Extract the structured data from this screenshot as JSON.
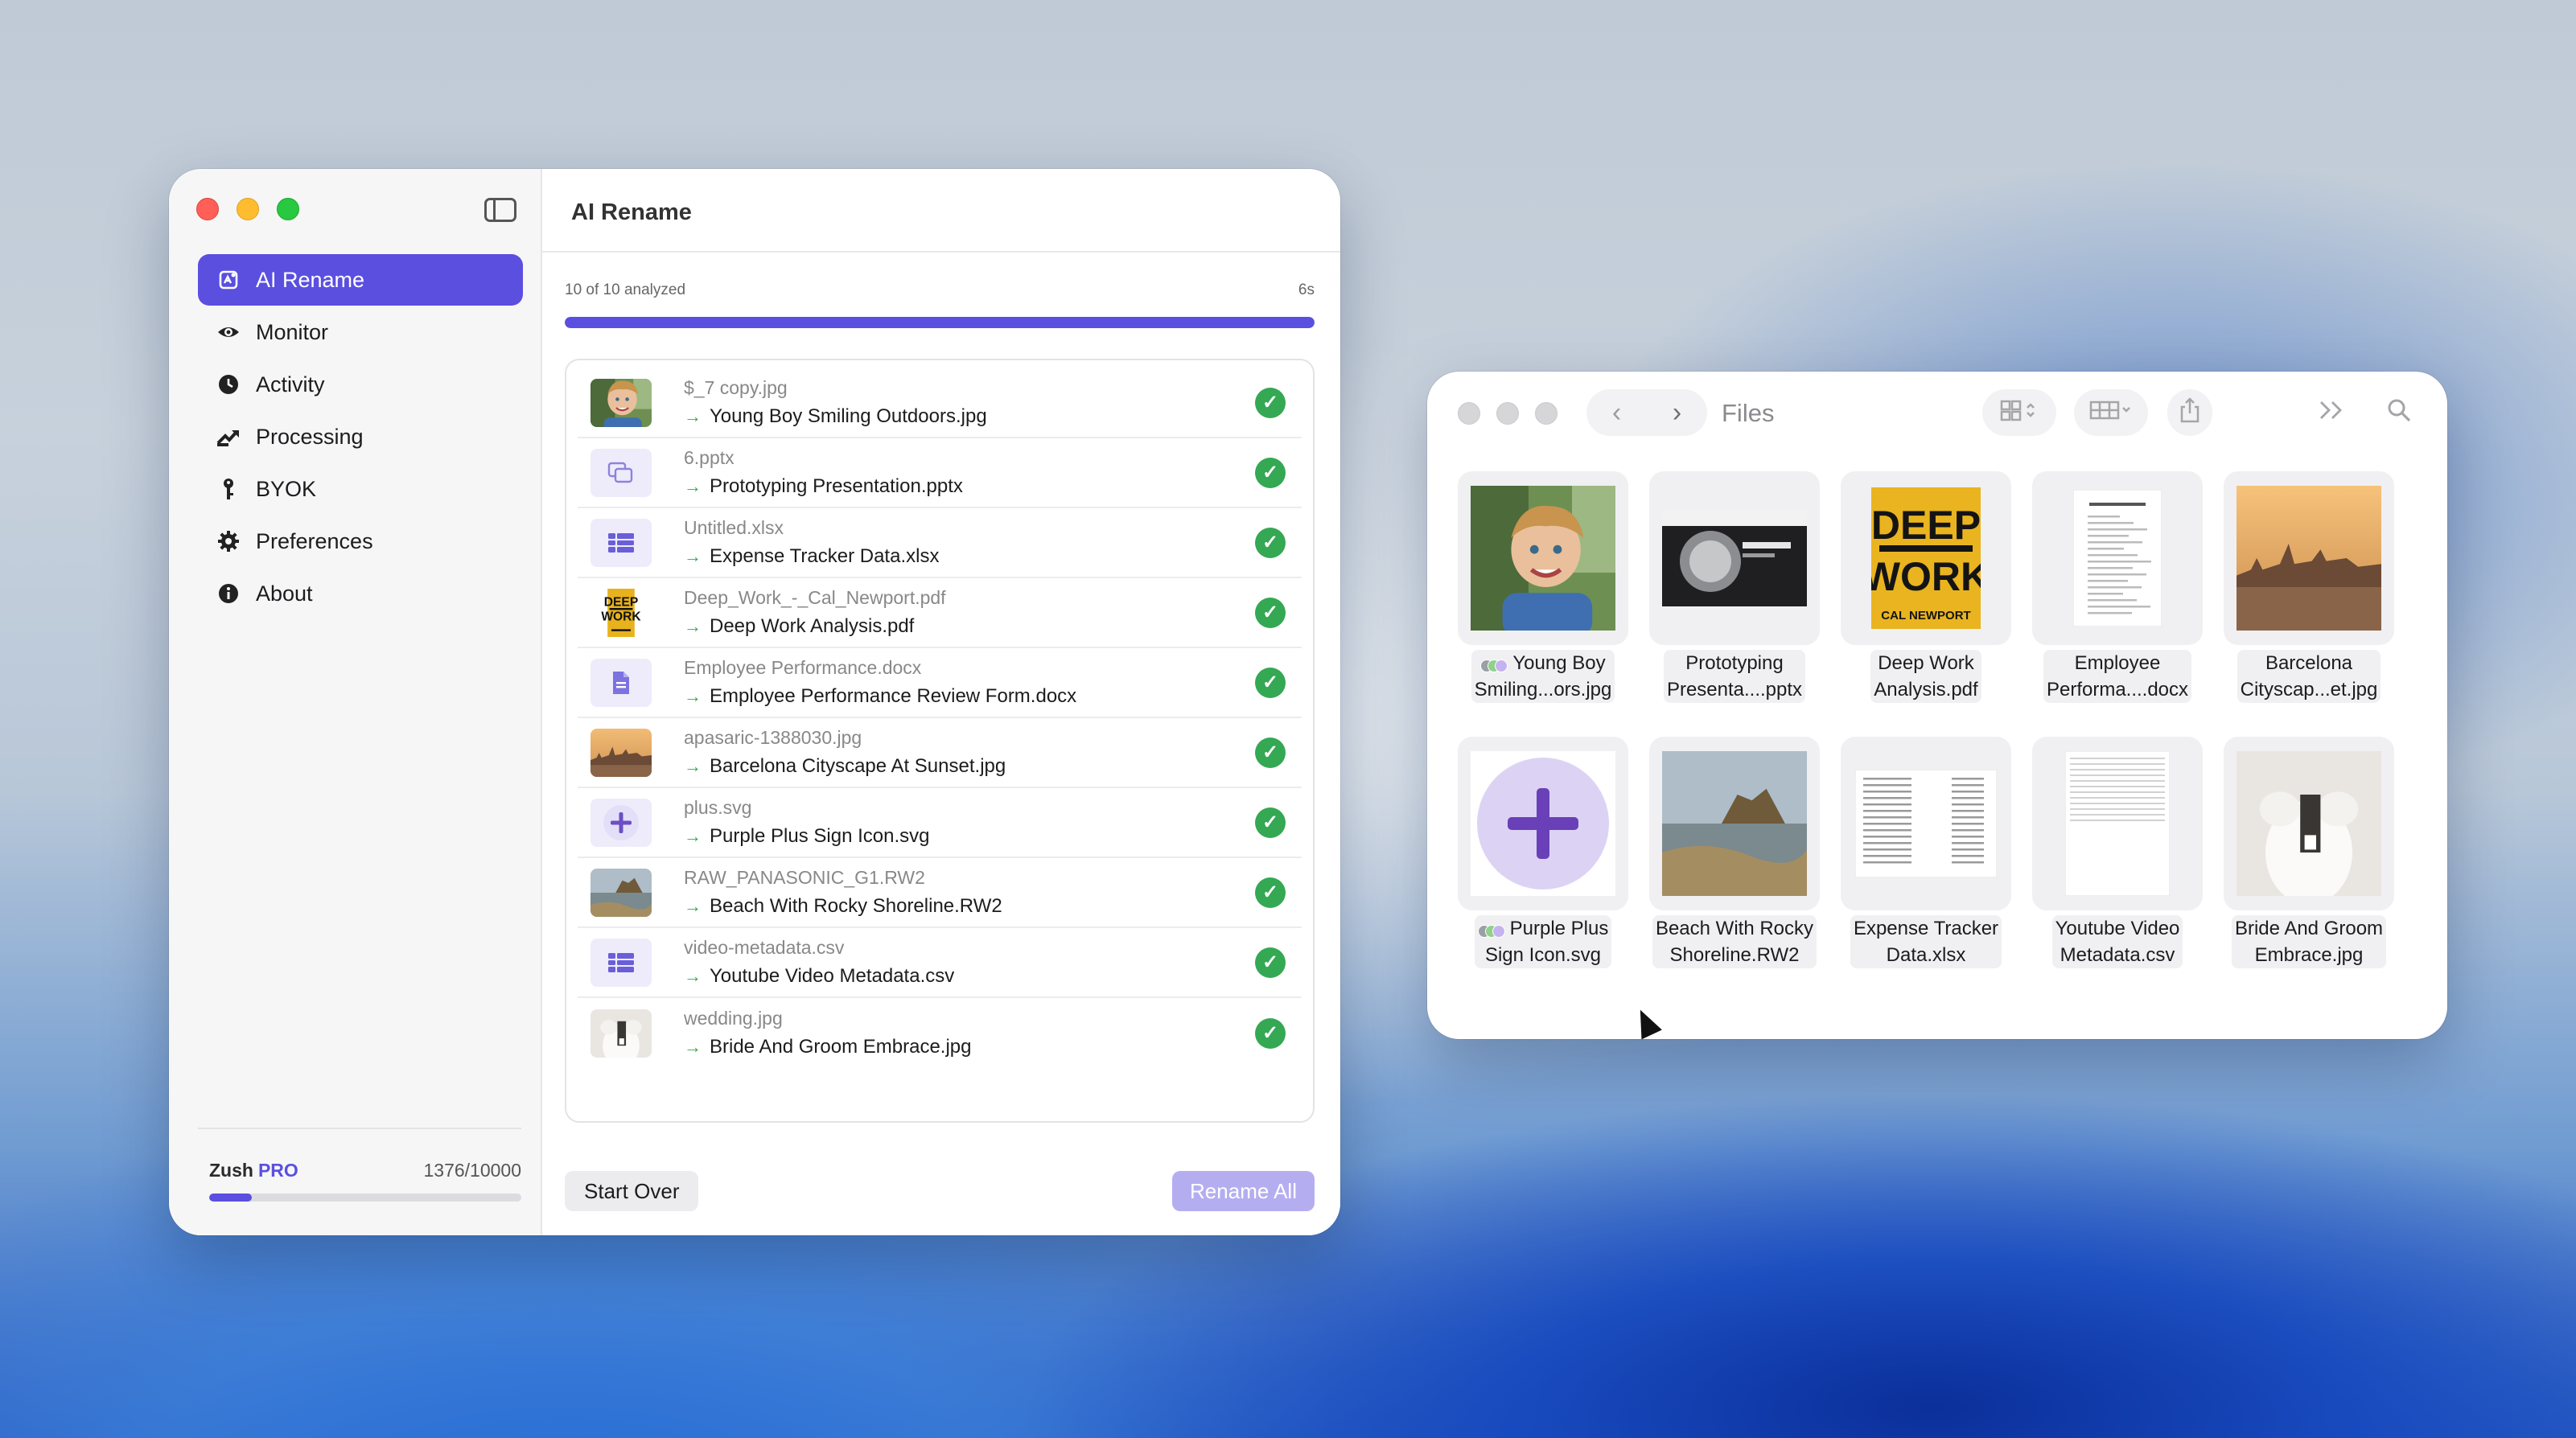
{
  "main_window": {
    "title": "AI Rename",
    "sidebar": {
      "items": [
        {
          "label": "AI Rename",
          "icon": "ai-rename-icon",
          "active": true
        },
        {
          "label": "Monitor",
          "icon": "eye-icon"
        },
        {
          "label": "Activity",
          "icon": "clock-icon"
        },
        {
          "label": "Processing",
          "icon": "processing-icon"
        },
        {
          "label": "BYOK",
          "icon": "key-icon"
        },
        {
          "label": "Preferences",
          "icon": "gear-icon"
        },
        {
          "label": "About",
          "icon": "info-icon"
        }
      ],
      "plan_name": "Zush",
      "plan_tier": "PRO",
      "usage_text": "1376/10000",
      "usage_fraction": 0.1376
    },
    "progress": {
      "label": "10 of 10 analyzed",
      "time": "6s",
      "fraction": 1.0
    },
    "files": [
      {
        "old": "$_7 copy.jpg",
        "new": "Young Boy Smiling Outdoors.jpg",
        "thumb": "photo-boy"
      },
      {
        "old": "6.pptx",
        "new": "Prototyping Presentation.pptx",
        "thumb": "slides-icon"
      },
      {
        "old": "Untitled.xlsx",
        "new": "Expense Tracker Data.xlsx",
        "thumb": "table-icon"
      },
      {
        "old": "Deep_Work_-_Cal_Newport.pdf",
        "new": "Deep Work Analysis.pdf",
        "thumb": "photo-book"
      },
      {
        "old": "Employee Performance.docx",
        "new": "Employee Performance Review Form.docx",
        "thumb": "document-icon"
      },
      {
        "old": "apasaric-1388030.jpg",
        "new": "Barcelona Cityscape At Sunset.jpg",
        "thumb": "photo-city"
      },
      {
        "old": "plus.svg",
        "new": "Purple Plus Sign Icon.svg",
        "thumb": "plus-icon"
      },
      {
        "old": "RAW_PANASONIC_G1.RW2",
        "new": "Beach With Rocky Shoreline.RW2",
        "thumb": "photo-beach"
      },
      {
        "old": "video-metadata.csv",
        "new": "Youtube Video Metadata.csv",
        "thumb": "table-icon"
      },
      {
        "old": "wedding.jpg",
        "new": "Bride And Groom Embrace.jpg",
        "thumb": "photo-wedding"
      }
    ],
    "buttons": {
      "start_over": "Start Over",
      "rename_all": "Rename All"
    }
  },
  "files_window": {
    "title": "Files",
    "items": [
      {
        "line1": "Young Boy",
        "line2": "Smiling...ors.jpg",
        "thumb": "photo-boy",
        "tagged": true
      },
      {
        "line1": "Prototyping",
        "line2": "Presenta....pptx",
        "thumb": "slides-preview"
      },
      {
        "line1": "Deep Work",
        "line2": "Analysis.pdf",
        "thumb": "book-cover"
      },
      {
        "line1": "Employee",
        "line2": "Performa....docx",
        "thumb": "doc-preview"
      },
      {
        "line1": "Barcelona",
        "line2": "Cityscap...et.jpg",
        "thumb": "photo-city"
      },
      {
        "line1": "Purple Plus",
        "line2": "Sign Icon.svg",
        "thumb": "plus-preview",
        "tagged": true
      },
      {
        "line1": "Beach With Rocky",
        "line2": "Shoreline.RW2",
        "thumb": "photo-beach"
      },
      {
        "line1": "Expense Tracker",
        "line2": "Data.xlsx",
        "thumb": "sheet-preview"
      },
      {
        "line1": "Youtube Video",
        "line2": "Metadata.csv",
        "thumb": "csv-preview"
      },
      {
        "line1": "Bride And Groom",
        "line2": "Embrace.jpg",
        "thumb": "photo-wedding"
      }
    ],
    "book_cover": {
      "title_top": "DEEP",
      "title_bottom": "WORK",
      "author": "CAL NEWPORT"
    }
  },
  "colors": {
    "accent": "#5b4fe0",
    "success": "#34a853",
    "close": "#ff5f57",
    "minimize": "#febc2e",
    "zoom": "#28c840"
  }
}
